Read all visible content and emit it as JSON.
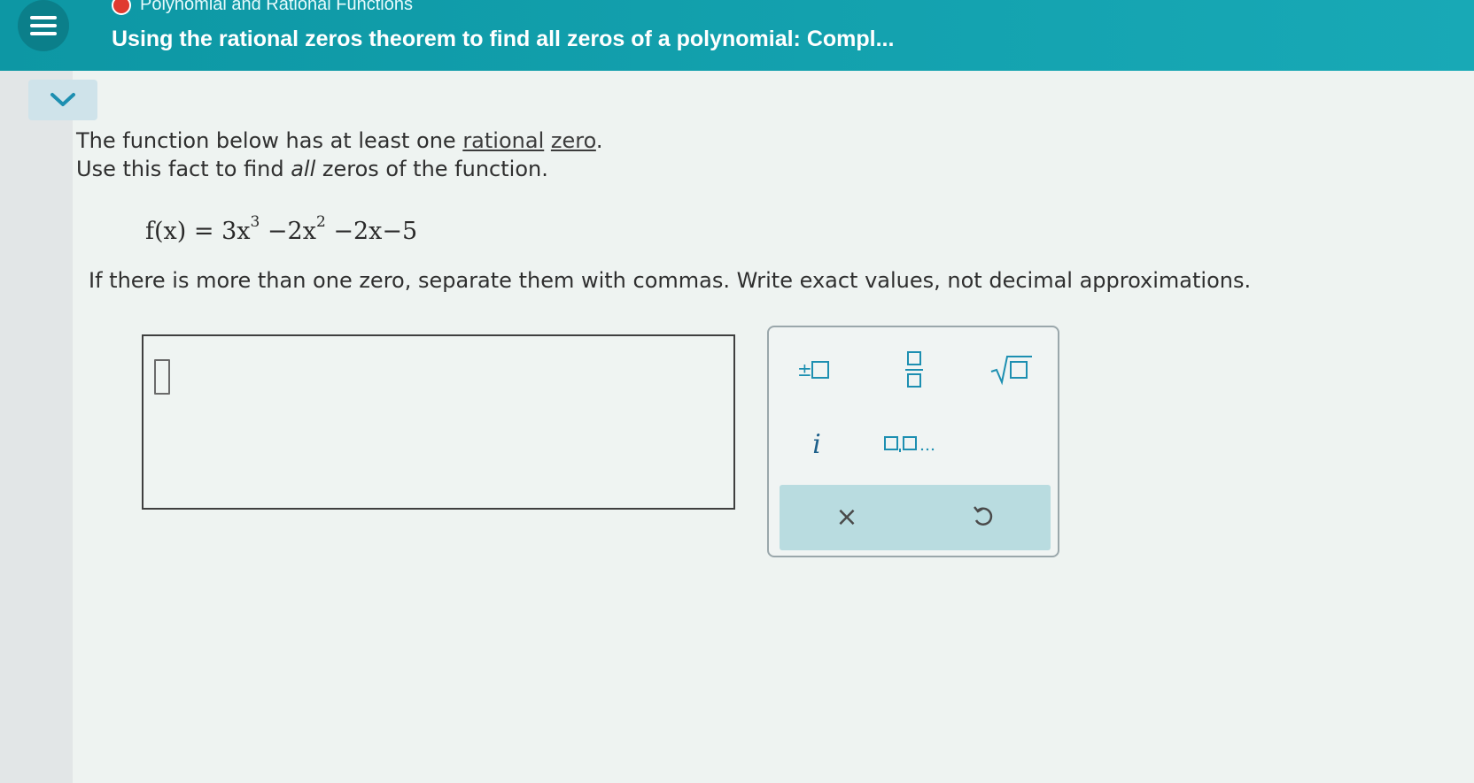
{
  "header": {
    "topic": "Polynomial and Rational Functions",
    "title": "Using the rational zeros theorem to find all zeros of a polynomial: Compl..."
  },
  "problem": {
    "line1_prefix": "The function below has at least one ",
    "term1": "rational",
    "term2": "zero",
    "line1_suffix": ".",
    "line2_prefix": "Use this fact to find ",
    "line2_emphasis": "all",
    "line2_suffix": " zeros of the function.",
    "formula": {
      "lhs": "f(x) = 3x",
      "exp1": "3",
      "mid1": " −2x",
      "exp2": "2",
      "tail": " −2x−5"
    },
    "instructions": "If there is more than one zero, separate them with commas. Write exact values, not decimal approximations."
  },
  "answer": {
    "value": ""
  },
  "keypad": {
    "keys": [
      "plus-minus",
      "fraction",
      "square-root",
      "imaginary-i",
      "list-separator"
    ],
    "i_label": "i",
    "clear_label": "×"
  },
  "colors": {
    "header": "#14a3b0",
    "accent_key": "#1d8fb1",
    "keypad_bottom": "#b9dce0"
  }
}
